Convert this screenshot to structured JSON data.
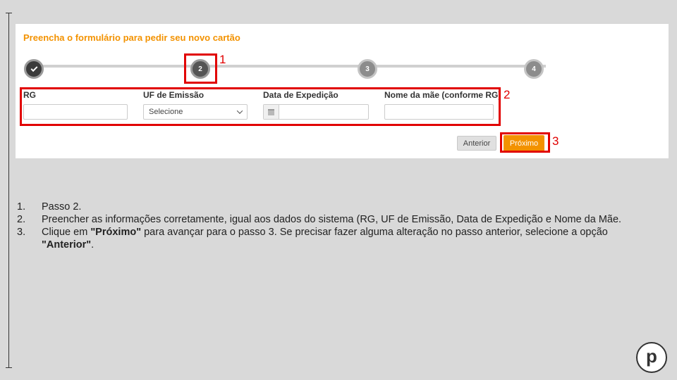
{
  "form": {
    "title": "Preencha o formulário para pedir seu novo cartão",
    "steps": [
      {
        "label": "",
        "state": "done"
      },
      {
        "label": "2",
        "state": "current"
      },
      {
        "label": "3",
        "state": "todo"
      },
      {
        "label": "4",
        "state": "todo"
      }
    ],
    "fields": {
      "rg": {
        "label": "RG",
        "value": ""
      },
      "uf": {
        "label": "UF de Emissão",
        "selected": "Selecione"
      },
      "date": {
        "label": "Data de Expedição",
        "value": ""
      },
      "mother": {
        "label": "Nome da mãe (conforme RG)",
        "value": ""
      }
    },
    "buttons": {
      "previous": "Anterior",
      "next": "Próximo"
    },
    "accent_color": "#f39200"
  },
  "annotations": [
    "1",
    "2",
    "3"
  ],
  "instructions": [
    {
      "num": "1.",
      "text": "Passo 2."
    },
    {
      "num": "2.",
      "text": "Preencher as informações corretamente, igual aos dados do sistema (RG, UF de Emissão, Data de Expedição e Nome da Mãe."
    },
    {
      "num": "3.",
      "pre": "Clique em ",
      "bold1": "\"Próximo\"",
      "mid": " para avançar para o passo 3. Se precisar fazer alguma alteração no passo anterior, selecione a opção ",
      "bold2": "\"Anterior\"",
      "post": "."
    }
  ],
  "logo": {
    "letter": "p"
  }
}
